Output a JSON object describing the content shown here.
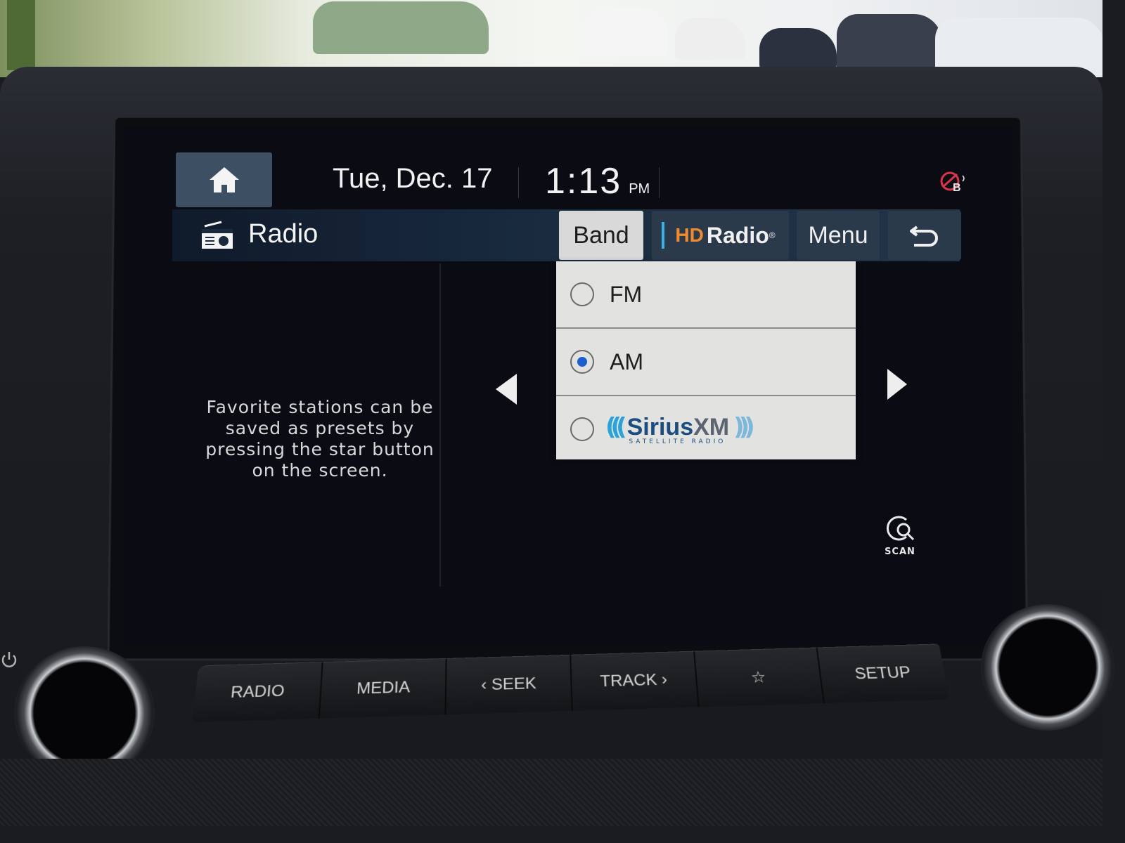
{
  "status_bar": {
    "home_icon": "home-icon",
    "date": "Tue, Dec. 17",
    "time": "1:13",
    "ampm": "PM",
    "bluetooth_icon": "bluetooth-audio-disconnected-icon"
  },
  "title_bar": {
    "icon": "radio-icon",
    "title": "Radio",
    "buttons": {
      "band": "Band",
      "hd_logo": "HD",
      "hd_radio": "Radio",
      "hd_registered": "®",
      "menu": "Menu",
      "back_icon": "back-arrow-icon"
    }
  },
  "content": {
    "hint": "Favorite stations can be saved as presets by pressing the star button on the screen.",
    "prev_icon": "triangle-left-icon",
    "next_icon": "triangle-right-icon",
    "scan_label": "SCAN"
  },
  "band_menu": {
    "options": [
      {
        "label": "FM",
        "selected": false
      },
      {
        "label": "AM",
        "selected": true
      },
      {
        "label": "SiriusXM",
        "selected": false,
        "logo_main_1": "Sirius",
        "logo_main_2": "XM",
        "logo_sub": "SATELLITE RADIO",
        "wave_left": "(((",
        "wave_right": ")))"
      }
    ]
  },
  "hardware_buttons": [
    {
      "label": "RADIO"
    },
    {
      "label": "MEDIA"
    },
    {
      "label": "‹ SEEK"
    },
    {
      "label": "TRACK ›"
    },
    {
      "label": "☆"
    },
    {
      "label": "SETUP"
    }
  ],
  "colors": {
    "accent_blue": "#1a5fd0",
    "hd_orange": "#f08a2e",
    "hd_bar_blue": "#3db0e6",
    "titlebar_blue": "#233447",
    "bt_red": "#d8344a"
  }
}
